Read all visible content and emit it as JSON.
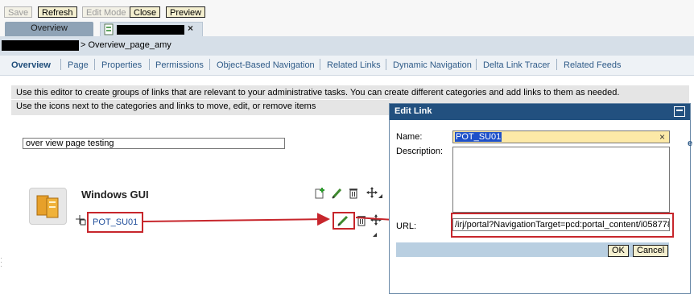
{
  "toolbar": {
    "buttons": [
      {
        "label": "Save",
        "enabled": false
      },
      {
        "label": "Refresh",
        "enabled": true
      },
      {
        "label": "Edit Mode",
        "enabled": false
      },
      {
        "label": "Close",
        "enabled": true
      },
      {
        "label": "Preview",
        "enabled": true
      }
    ]
  },
  "tabs": {
    "overview_label": "Overview",
    "close_glyph": "×"
  },
  "breadcrumb": {
    "text": "> Overview_page_amy"
  },
  "nav": {
    "items": [
      "Overview",
      "Page",
      "Properties",
      "Permissions",
      "Object-Based Navigation",
      "Related Links",
      "Dynamic Navigation",
      "Delta Link Tracer",
      "Related Feeds"
    ],
    "active": "Overview"
  },
  "info": {
    "line1": "Use this editor to create groups of links that are relevant to your administrative tasks. You can create different categories and add links to them as needed.",
    "line2": "Use the icons next to the categories and links to move, edit, or remove items"
  },
  "editor": {
    "category_input_value": "over view page testing",
    "category_title": "Windows GUI",
    "link_label": "POT_SU01"
  },
  "dialog": {
    "title": "Edit Link",
    "name_label": "Name:",
    "name_value": "POT_SU01",
    "description_label": "Description:",
    "description_value": "",
    "url_label": "URL:",
    "url_value": "/irj/portal?NavigationTarget=pcd:portal_content/i058778",
    "ok_label": "OK",
    "cancel_label": "Cancel"
  },
  "colors": {
    "highlight": "#c7262c",
    "dialog_titlebar": "#22507f",
    "nav_link": "#2f5b88"
  }
}
